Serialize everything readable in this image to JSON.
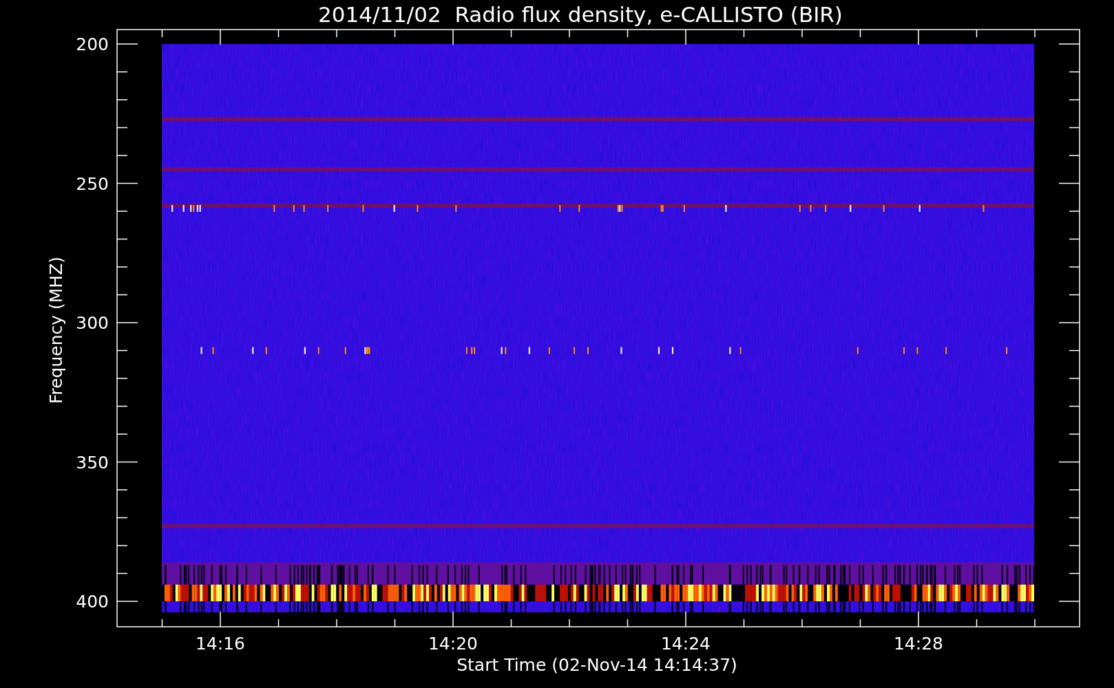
{
  "title": "2014/11/02  Radio flux density, e-CALLISTO (BIR)",
  "y_axis": {
    "label": "Frequency (MHZ)",
    "ticks": [
      "200",
      "250",
      "300",
      "350",
      "400"
    ]
  },
  "x_axis": {
    "label": "Start Time (02-Nov-14 14:14:37)",
    "ticks": [
      "14:16",
      "14:20",
      "14:24",
      "14:28"
    ]
  }
}
